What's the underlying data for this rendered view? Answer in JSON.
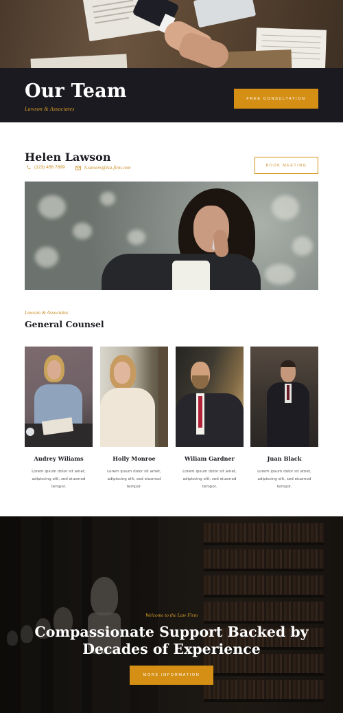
{
  "header": {
    "title": "Our Team",
    "subtitle": "Lawson & Associates",
    "cta_label": "Free Consultation"
  },
  "profile": {
    "name": "Helen Lawson",
    "phone": "(123) 456 7899",
    "email": "h.stevens@lsa-firm.com",
    "book_label": "Book Meeting",
    "icons": {
      "phone": "phone-icon",
      "email": "envelope-icon"
    }
  },
  "team_section": {
    "kicker": "Lawson & Associates",
    "title": "General Counsel",
    "members": [
      {
        "name": "Audrey Wiliams",
        "bio": "Lorem ipsum dolor sit amet, adipiscing elit, sed eiusmod tempor."
      },
      {
        "name": "Holly Monroe",
        "bio": "Lorem ipsum dolor sit amet, adipiscing elit, sed eiusmod tempor."
      },
      {
        "name": "Wiliam Gardner",
        "bio": "Lorem ipsum dolor sit amet, adipiscing elit, sed eiusmod tempor."
      },
      {
        "name": "Juan Black",
        "bio": "Lorem ipsum dolor sit amet, adipiscing elit, sed eiusmod tempor."
      }
    ]
  },
  "cta": {
    "kicker": "Welcome to the Law Firm",
    "heading": "Compassionate Support Backed by Decades of Experience",
    "button_label": "More Information"
  },
  "colors": {
    "accent": "#d48f14",
    "dark_band": "#1b1a21",
    "text_dark": "#1c1b22"
  }
}
